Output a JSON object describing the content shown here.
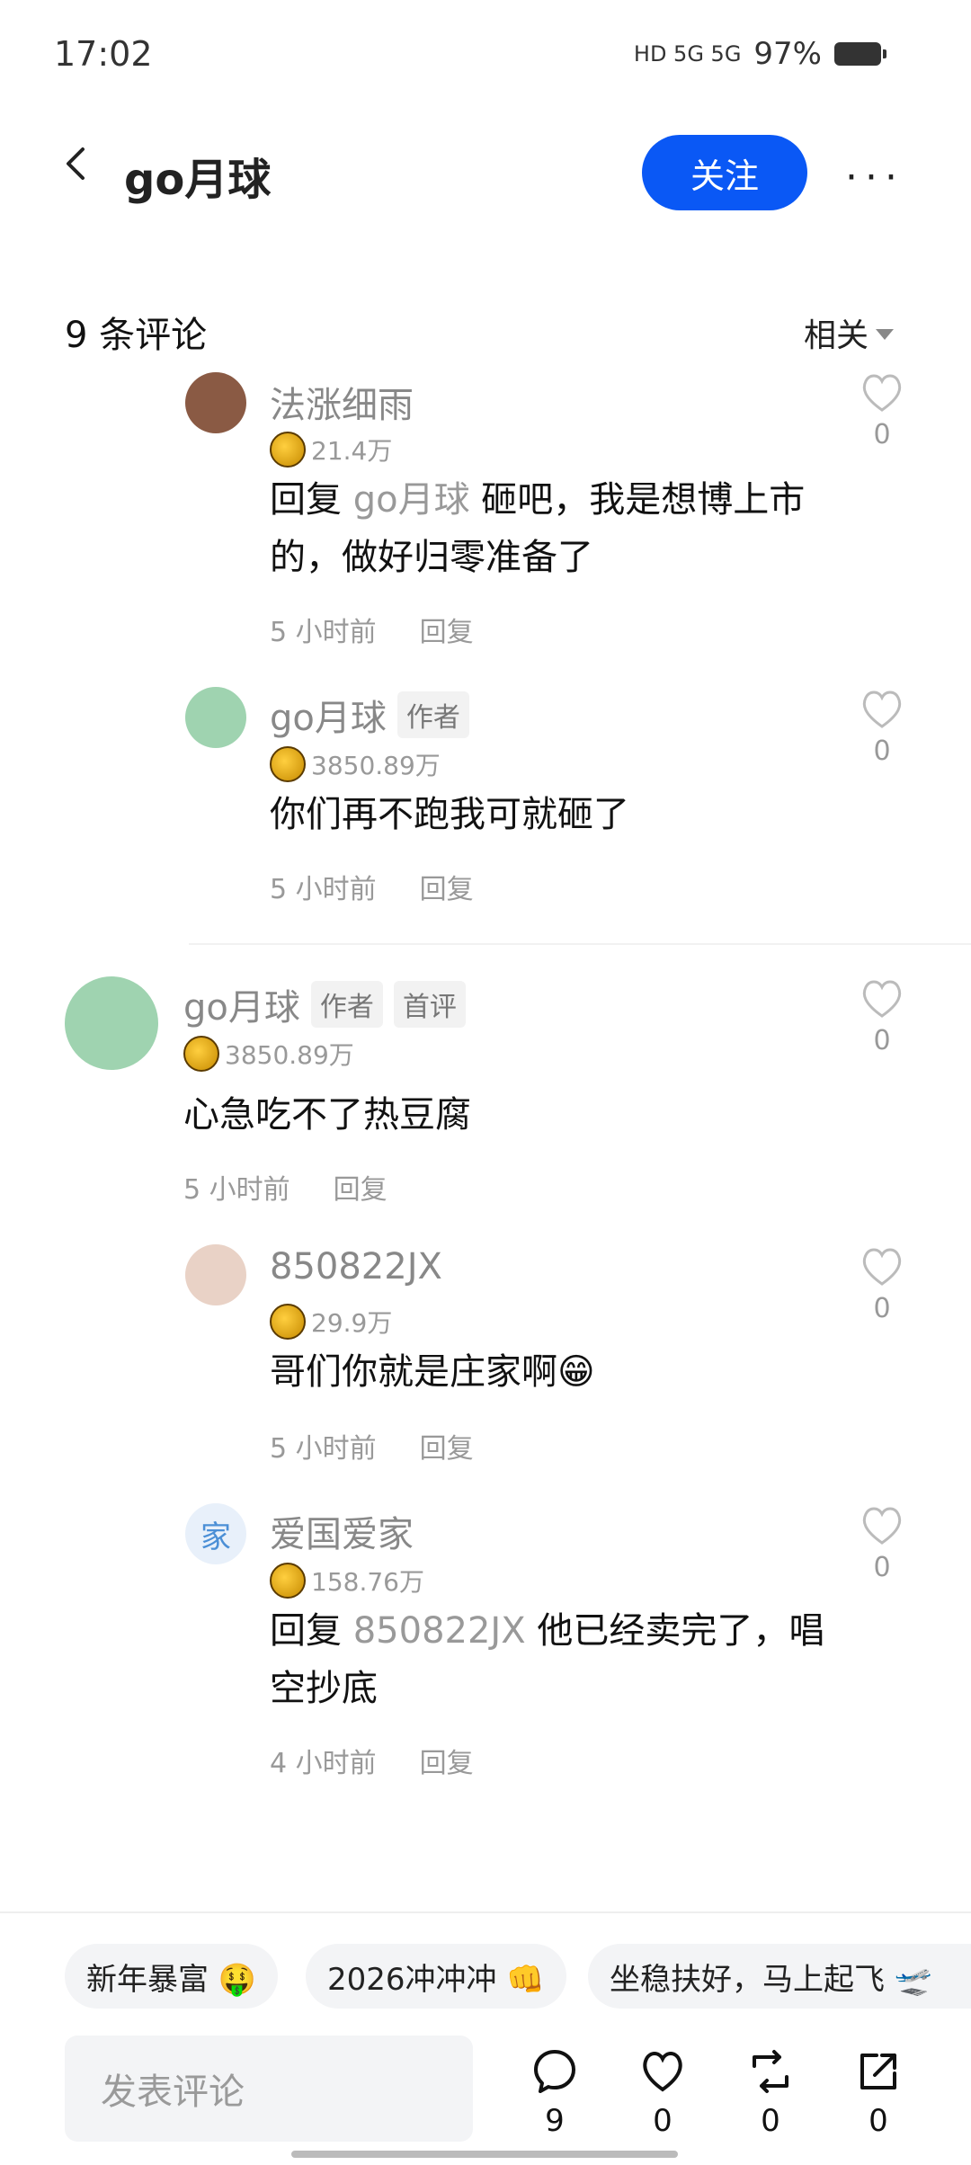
{
  "status": {
    "time": "17:02",
    "signal": "HD 5G 5G",
    "battery": "97%"
  },
  "header": {
    "title": "go月球",
    "follow": "关注",
    "more": "···"
  },
  "comments_header": {
    "count": "9 条评论",
    "sort": "相关"
  },
  "comments": [
    {
      "name": "法涨细雨",
      "level": "21.4万",
      "reply_prefix": "回复",
      "reply_to": "go月球",
      "text": " 砸吧，我是想博上市的，做好归零准备了",
      "time": "5 小时前",
      "reply": "回复",
      "likes": "0"
    },
    {
      "name": "go月球",
      "tag1": "作者",
      "level": "3850.89万",
      "text": "你们再不跑我可就砸了",
      "time": "5 小时前",
      "reply": "回复",
      "likes": "0"
    },
    {
      "name": "go月球",
      "tag1": "作者",
      "tag2": "首评",
      "level": "3850.89万",
      "text": "心急吃不了热豆腐",
      "time": "5 小时前",
      "reply": "回复",
      "likes": "0"
    },
    {
      "name": "850822JX",
      "level": "29.9万",
      "text": "哥们你就是庄家啊😁",
      "time": "5 小时前",
      "reply": "回复",
      "likes": "0"
    },
    {
      "name": "爱国爱家",
      "avatar_char": "家",
      "level": "158.76万",
      "reply_prefix": "回复",
      "reply_to": "850822JX",
      "text": " 他已经卖完了，唱空抄底",
      "time": "4 小时前",
      "reply": "回复",
      "likes": "0"
    }
  ],
  "chips": [
    "新年暴富 🤑",
    "2026冲冲冲 👊",
    "坐稳扶好，马上起飞 🛫"
  ],
  "bottom": {
    "placeholder": "发表评论",
    "comments": "9",
    "likes": "0",
    "reposts": "0",
    "shares": "0"
  }
}
